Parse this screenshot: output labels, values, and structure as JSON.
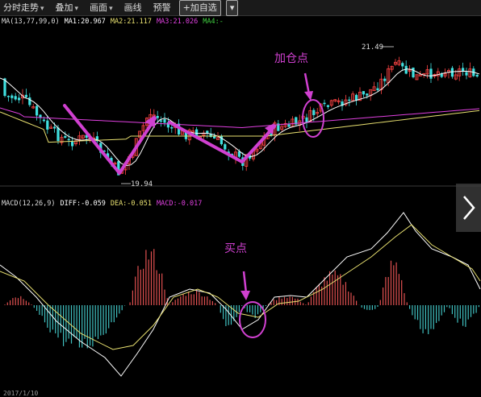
{
  "toolbar": {
    "items": [
      {
        "label": "分时走势",
        "dropdown": true
      },
      {
        "label": "叠加",
        "dropdown": true
      },
      {
        "label": "画面",
        "dropdown": true
      },
      {
        "label": "画线",
        "dropdown": false
      },
      {
        "label": "预警",
        "dropdown": false
      }
    ],
    "add_watch": "+加自选",
    "add_watch_menu_icon": "chevron-down-icon"
  },
  "upper_panel": {
    "legend": [
      {
        "text": "MA(13,77,99,0)",
        "color": "#dddddd"
      },
      {
        "text": "MA1:20.967",
        "color": "#ffffff"
      },
      {
        "text": "MA2:21.117",
        "color": "#e8e070"
      },
      {
        "text": "MA3:21.026",
        "color": "#e040e0"
      },
      {
        "text": "MA4:-",
        "color": "#40d040"
      }
    ],
    "high_label": "21.49",
    "low_label": "19.94",
    "annotation": "加仓点"
  },
  "lower_panel": {
    "legend": [
      {
        "text": "MACD(12,26,9)",
        "color": "#dddddd"
      },
      {
        "text": "DIFF:-0.059",
        "color": "#ffffff"
      },
      {
        "text": "DEA:-0.051",
        "color": "#e8e070"
      },
      {
        "text": "MACD:-0.017",
        "color": "#e040e0"
      }
    ],
    "annotation": "买点"
  },
  "nav": {
    "next_icon": "chevron-right-icon"
  },
  "footer": {
    "date": "2017/1/10"
  },
  "colors": {
    "up": "#ff4444",
    "down": "#40e0e0",
    "annotation": "#d040d0",
    "ma1": "#ffffff",
    "ma2": "#e8e070",
    "ma3": "#e040e0"
  }
}
